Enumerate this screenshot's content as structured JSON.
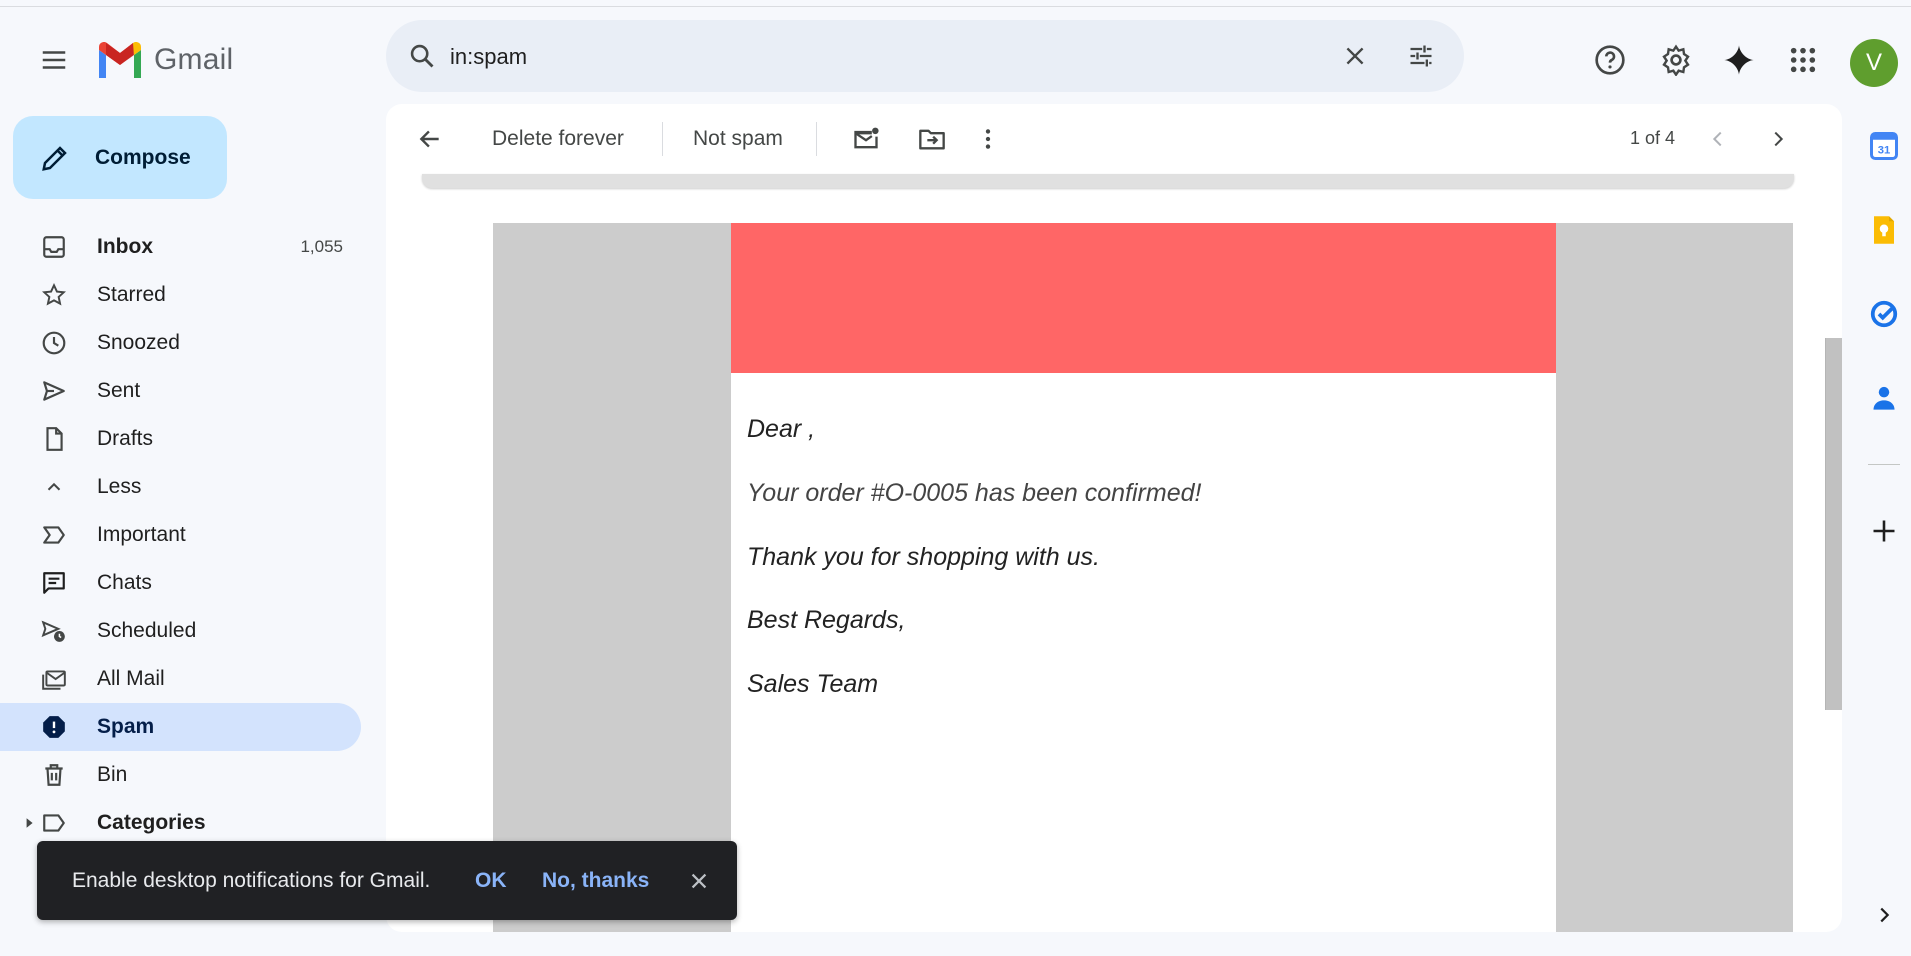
{
  "app": {
    "name": "Gmail"
  },
  "search": {
    "query": "in:spam"
  },
  "header": {
    "icons": [
      "menu-icon",
      "help-icon",
      "settings-icon",
      "gemini-icon",
      "apps-icon"
    ],
    "avatar_initial": "V",
    "avatar_color": "#5f9e2e"
  },
  "compose": {
    "label": "Compose"
  },
  "sidebar": {
    "items": [
      {
        "label": "Inbox",
        "count": "1,055",
        "icon": "inbox-icon"
      },
      {
        "label": "Starred",
        "count": "",
        "icon": "star-icon"
      },
      {
        "label": "Snoozed",
        "count": "",
        "icon": "clock-icon"
      },
      {
        "label": "Sent",
        "count": "",
        "icon": "send-icon"
      },
      {
        "label": "Drafts",
        "count": "",
        "icon": "draft-icon"
      },
      {
        "label": "Less",
        "count": "",
        "icon": "chevron-up-icon"
      },
      {
        "label": "Important",
        "count": "",
        "icon": "important-icon"
      },
      {
        "label": "Chats",
        "count": "",
        "icon": "chat-icon"
      },
      {
        "label": "Scheduled",
        "count": "",
        "icon": "scheduled-icon"
      },
      {
        "label": "All Mail",
        "count": "",
        "icon": "all-mail-icon"
      },
      {
        "label": "Spam",
        "count": "",
        "icon": "spam-icon"
      },
      {
        "label": "Bin",
        "count": "",
        "icon": "trash-icon"
      },
      {
        "label": "Categories",
        "count": "",
        "icon": "label-icon"
      }
    ]
  },
  "toolbar": {
    "delete_forever": "Delete forever",
    "not_spam": "Not spam",
    "pager": "1 of 4"
  },
  "email": {
    "banner_color": "#ff6666",
    "lines": [
      "Dear ,",
      "Your order #O-0005 has been confirmed!",
      "Thank you for shopping with us.",
      "Best Regards,",
      "Sales Team"
    ]
  },
  "snackbar": {
    "message": "Enable desktop notifications for Gmail.",
    "ok": "OK",
    "no_thanks": "No, thanks"
  }
}
